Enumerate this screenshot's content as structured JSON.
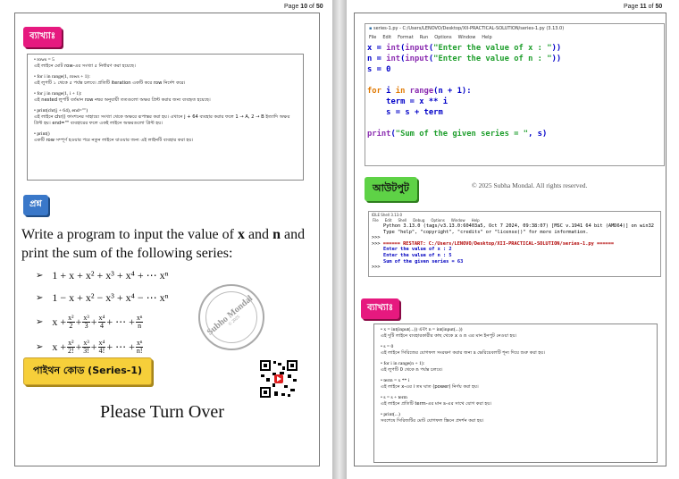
{
  "left_page": {
    "page_number": {
      "prefix": "Page ",
      "current": "10",
      "mid": " of ",
      "total": "50"
    },
    "explanation_badge": "ব্যাখ্যাঃ",
    "explanation_items": [
      {
        "code": "• rows = 5",
        "desc": "এই লাইনে মোট row-এর সংখ্যা ৫ নির্ধারণ করা হয়েছে।"
      },
      {
        "code": "• for i in range(1, rows + 1):",
        "desc": "এই লুপটি ১ থেকে ৫ পর্যন্ত চলবে। প্রতিটি iteration একটি করে row নির্দেশ করে।"
      },
      {
        "code": "• for j in range(1, i + 1):",
        "desc": "এই nested লুপটি বর্তমান row নম্বর অনুযায়ী ততগুলো অক্ষর প্রিন্ট করার জন্য ব্যবহৃত হয়েছে।"
      },
      {
        "code": "• print(chr(j + 64), end=\"\")",
        "desc": "এই লাইনে chr() ফাংশনের সাহায্যে সংখ্যা থেকে অক্ষরে রূপান্তর করা হয়। এখানে j + 64 ব্যবহার করার ফলে 1 → A, 2 → B ইত্যাদি অক্ষর প্রিন্ট হয়। end=\"\" ব্যবহারের ফলে একই লাইনে অক্ষরগুলো প্রিন্ট হয়।"
      },
      {
        "code": "• print()",
        "desc": "একটি row সম্পূর্ণ হওয়ার পরে নতুন লাইনে যাওয়ার জন্য এই লাইনটি ব্যবহার করা হয়।"
      }
    ],
    "question_badge": "প্রশ্ন",
    "question": {
      "p1": "Write a program to input the value of ",
      "x": "x",
      "p2": " and ",
      "n": "n",
      "p3": " and print the sum of the following series:"
    },
    "series": [
      {
        "text": "1 + x + x² + x³ + x⁴ + ⋯ xⁿ"
      },
      {
        "text": "1 − x + x² − x³ + x⁴ − ⋯ xⁿ"
      },
      {
        "lead": "x +",
        "terms": [
          [
            "x²",
            "2"
          ],
          [
            "x³",
            "3"
          ],
          [
            "x⁴",
            "4"
          ]
        ],
        "tail": [
          "xⁿ",
          "n"
        ]
      },
      {
        "lead": "x +",
        "terms": [
          [
            "x²",
            "2!"
          ],
          [
            "x³",
            "3!"
          ],
          [
            "x⁴",
            "4!"
          ]
        ],
        "tail": [
          "xⁿ",
          "n!"
        ]
      }
    ],
    "plus": "+",
    "dots": "+ ⋯ +",
    "stamp_name": "Subho Mondal",
    "stamp_year": "© 2025",
    "code_badge": "পাইথন কোড (Series-1)",
    "turn_over": "Please Turn Over"
  },
  "right_page": {
    "page_number": {
      "prefix": "Page ",
      "current": "11",
      "mid": " of ",
      "total": "50"
    },
    "editor": {
      "title": "series-1.py - C:/Users/LENOVO/Desktop/XII-PRACTICAL-SOLUTION/series-1.py (3.13.0)",
      "menu": [
        "File",
        "Edit",
        "Format",
        "Run",
        "Options",
        "Window",
        "Help"
      ]
    },
    "output_badge": "আউটপুট",
    "copyright": "© 2025 Subha Mondal. All rights reserved.",
    "shell": {
      "title": "IDLE Shell 3.13.0",
      "menu": [
        "File",
        "Edit",
        "Shell",
        "Debug",
        "Options",
        "Window",
        "Help"
      ],
      "banner1": "Python 3.13.0 (tags/v3.13.0:60403a5, Oct  7 2024, 09:38:07) [MSC v.1941 64 bit (AMD64)] on win32",
      "banner2": "Type \"help\", \"copyright\", \"credits\" or \"license()\" for more information.",
      "prompt": ">>>",
      "restart": "====== RESTART: C:/Users/LENOVO/Desktop/XII-PRACTICAL-SOLUTION/series-1.py ======",
      "line1": "Enter the value of x : 2",
      "line2": "Enter the value of n : 5",
      "line3": "Sum of the given series =  63"
    },
    "explanation_badge": "ব্যাখ্যাঃ",
    "explanation_items": [
      {
        "code": "• x = int(input(...)) এবং n = int(input(...))",
        "desc": "এই দুটি লাইনে ব্যবহারকারীর কাছ থেকে x ও n এর মান ইনপুট নেওয়া হয়।"
      },
      {
        "code": "• s = 0",
        "desc": "এই লাইনে সিরিজের যোগফল সংরক্ষণ করার জন্য s ভেরিয়েবলটি শূন্য দিয়ে শুরু করা হয়।"
      },
      {
        "code": "• for i in range(n + 1):",
        "desc": "এই লুপটি 0 থেকে n পর্যন্ত চলবে।"
      },
      {
        "code": "• term = x ** i",
        "desc": "এই লাইনে x-এর i তম ঘাত (power) নির্ণয় করা হয়।"
      },
      {
        "code": "• s = s + term",
        "desc": "এই লাইনে প্রতিটি term-এর মান s-এর সাথে যোগ করা হয়।"
      },
      {
        "code": "• print(...)",
        "desc": "সবশেষে সিরিজটির মোট যোগফল স্ক্রিনে প্রদর্শন করা হয়।"
      }
    ]
  }
}
